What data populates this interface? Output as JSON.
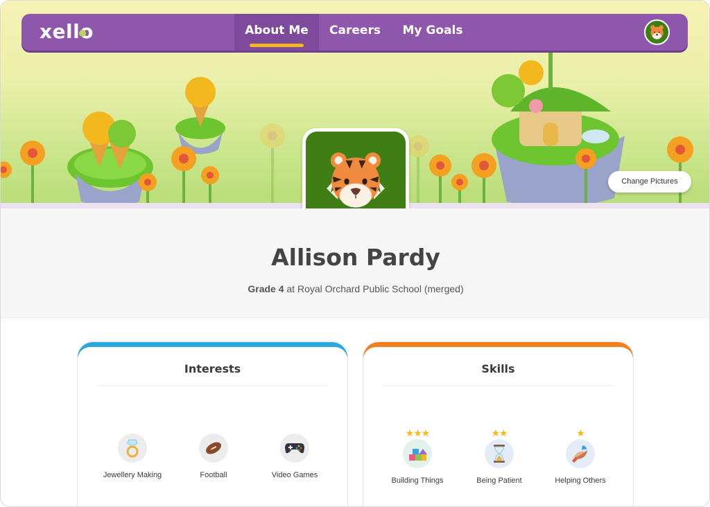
{
  "brand": {
    "logo_text": "xello"
  },
  "nav": {
    "tabs": [
      {
        "label": "About Me",
        "active": true
      },
      {
        "label": "Careers",
        "active": false
      },
      {
        "label": "My Goals",
        "active": false
      }
    ],
    "avatar_icon": "tiger-icon"
  },
  "hero": {
    "change_pictures_label": "Change Pictures"
  },
  "profile": {
    "avatar_icon": "tiger-icon",
    "name": "Allison Pardy",
    "grade": "Grade 4",
    "school_text": "at Royal Orchard Public School (merged)"
  },
  "interests": {
    "title": "Interests",
    "accent_color": "#2ba7dd",
    "items": [
      {
        "label": "Jewellery Making",
        "icon": "ring-icon"
      },
      {
        "label": "Football",
        "icon": "football-icon"
      },
      {
        "label": "Video Games",
        "icon": "game-controller-icon"
      }
    ]
  },
  "skills": {
    "title": "Skills",
    "accent_color": "#ee7e1e",
    "items": [
      {
        "label": "Building Things",
        "icon": "building-blocks-icon",
        "stars": "★★★"
      },
      {
        "label": "Being Patient",
        "icon": "hourglass-icon",
        "stars": "★★"
      },
      {
        "label": "Helping Others",
        "icon": "helping-hands-icon",
        "stars": "★"
      }
    ]
  },
  "colors": {
    "nav_purple": "#8e57ab",
    "tab_indicator": "#f2b81e",
    "avatar_green": "#3f7d15",
    "star_gold": "#f5b91a"
  }
}
